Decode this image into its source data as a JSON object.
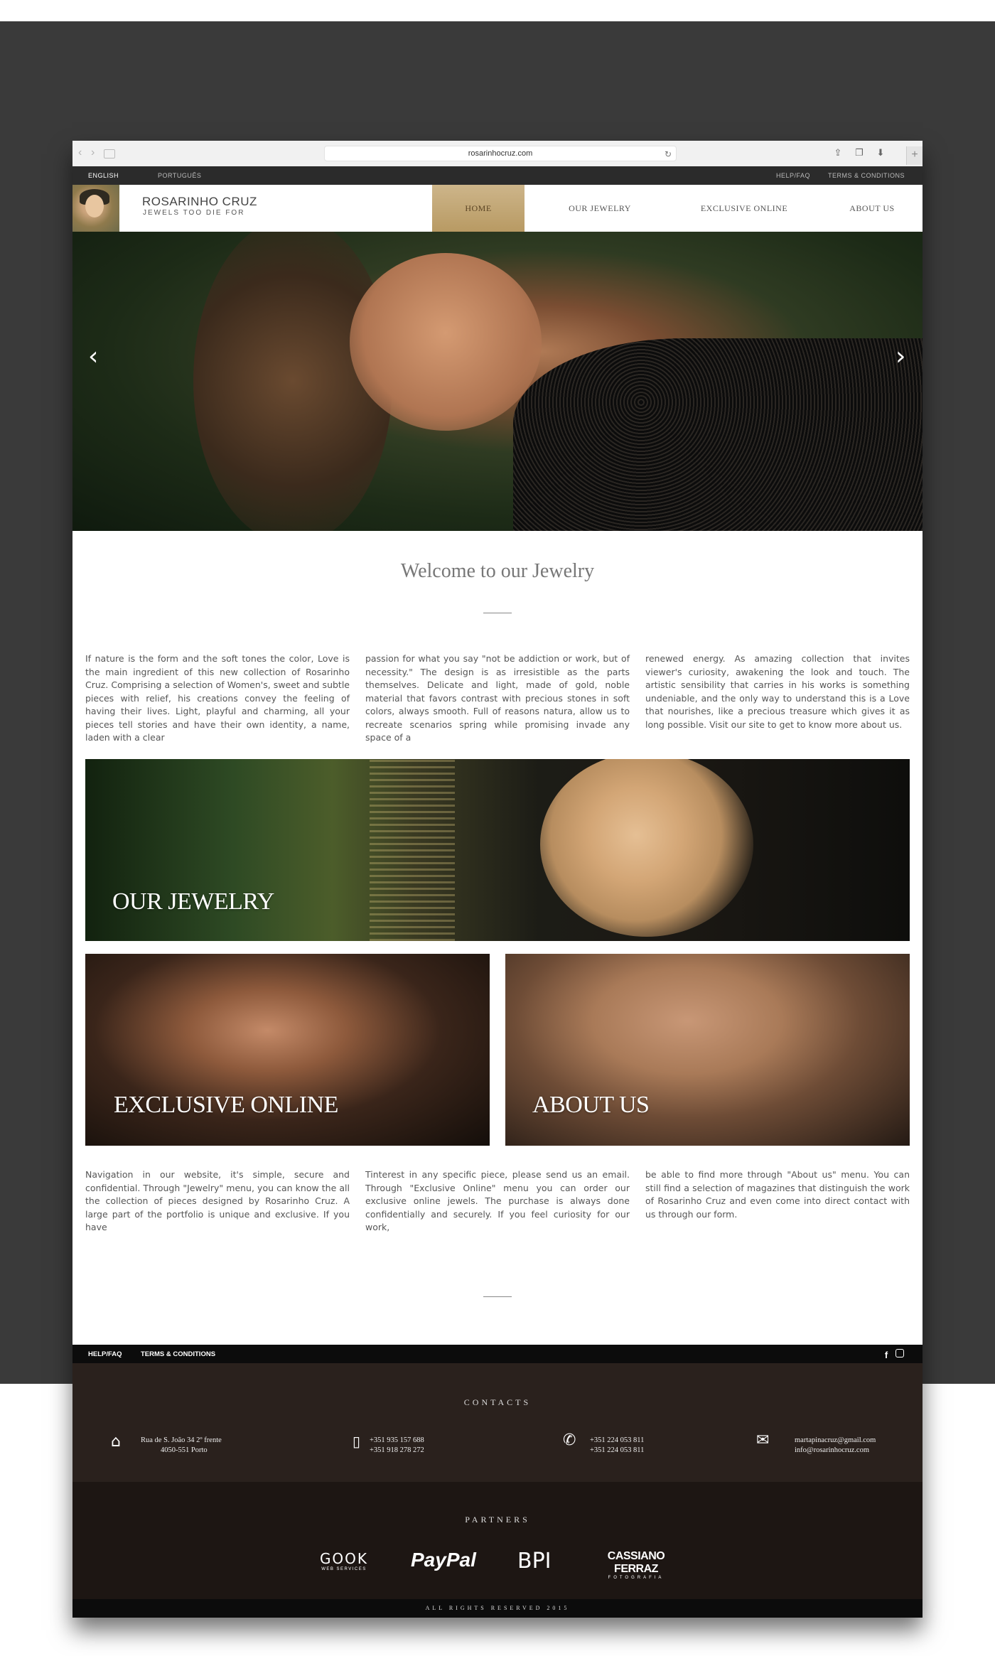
{
  "browser": {
    "url": "rosarinhocruz.com",
    "back_icon": "chevron-left-icon",
    "forward_icon": "chevron-right-icon"
  },
  "topbar": {
    "lang_english": "ENGLISH",
    "lang_portuguese": "PORTUGUÊS",
    "help": "HELP/FAQ",
    "terms": "TERMS & CONDITIONS"
  },
  "header": {
    "brand": "ROSARINHO CRUZ",
    "tagline": "JEWELS TOO DIE FOR",
    "menu": [
      "HOME",
      "OUR JEWELRY",
      "EXCLUSIVE ONLINE",
      "ABOUT US"
    ],
    "active_color": "#c4a872"
  },
  "hero": {
    "prev_glyph": "‹",
    "next_glyph": "›"
  },
  "welcome": {
    "title": "Welcome to our Jewelry",
    "col1": "If nature is the form and the soft tones the color, Love is the main ingredient of this new collection of Rosarinho Cruz. Comprising a selection of Women's, sweet and subtle pieces with relief, his creations convey the feeling of having their lives. Light, playful and charming, all your pieces tell stories and have their own identity, a name, laden with a clear",
    "col2": "passion for what you say \"not be addiction or work, but of necessity.\" The design is as irresistible as the parts themselves. Delicate and light, made of gold, noble material that favors contrast with precious stones in soft colors, always smooth. Full of reasons natura, allow us to recreate scenarios spring while promising invade any space of a",
    "col3": "renewed energy. As amazing collection that invites viewer's curiosity, awakening the look and touch. The artistic sensibility that carries in his works is something undeniable, and the only way to understand this is a Love that nourishes, like a precious treasure which gives it as long possible. Visit our site to get to know more about us."
  },
  "tiles": {
    "jewelry": "OUR JEWELRY",
    "exclusive": "EXCLUSIVE ONLINE",
    "about": "ABOUT US"
  },
  "info": {
    "col1": "Navigation in our website, it's simple, secure and confidential. Through \"Jewelry\" menu, you can know the all the collection of pieces designed by Rosarinho Cruz. A large part of the portfolio is unique and exclusive. If you have",
    "col2": "Tinterest in any specific piece, please send us an email. Through \"Exclusive Online\" menu you can order our exclusive online jewels. The purchase is always done confidentially and securely. If you feel curiosity for our work,",
    "col3": "be able to find more through \"About us\" menu. You can still find a selection of magazines that distinguish the work of Rosarinho Cruz and even come into direct contact with us through our form."
  },
  "footer": {
    "help": "HELP/FAQ",
    "terms": "TERMS & CONDITIONS",
    "contacts_title": "CONTACTS",
    "address_line1": "Rua de S. João 34 2º frente",
    "address_line2": "4050-551 Porto",
    "mobile_line1": "+351 935 157 688",
    "mobile_line2": "+351 918 278 272",
    "phone_line1": "+351 224 053 811",
    "phone_line2": "+351 224 053 811",
    "email_line1": "martapinacruz@gmail.com",
    "email_line2": "info@rosarinhocruz.com",
    "partners_title": "PARTNERS",
    "partners": [
      "GOOK",
      "WEB SERVICES",
      "PayPal",
      "BPI",
      "CASSIANO FERRAZ",
      "FOTOGRAFIA"
    ],
    "rights": "ALL RIGHTS RESERVED 2015"
  }
}
